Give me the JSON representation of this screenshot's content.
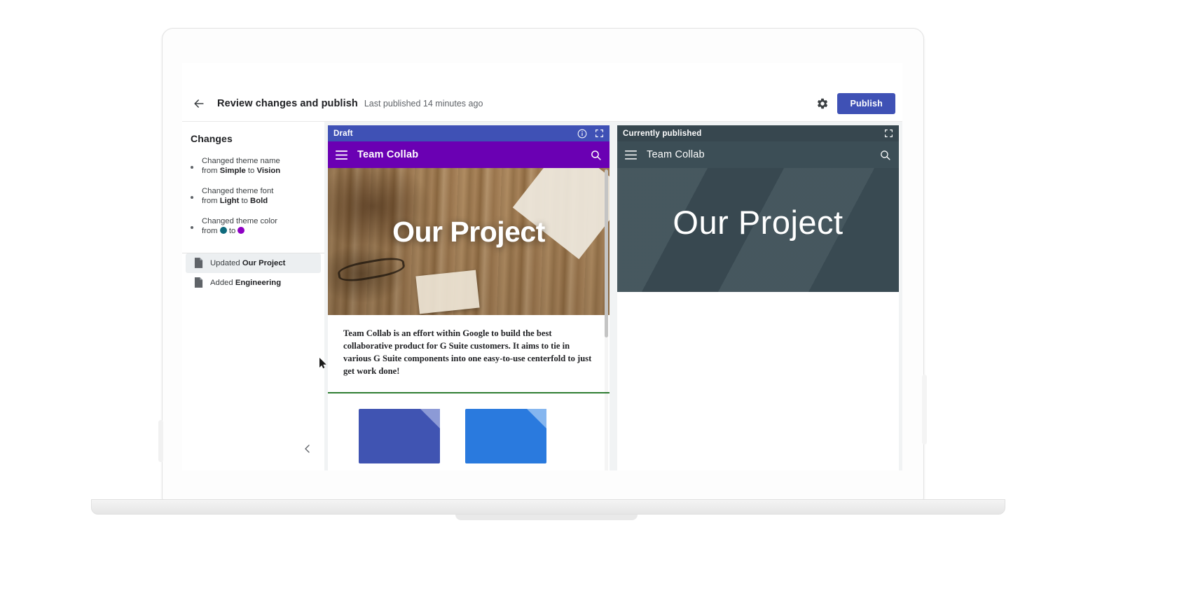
{
  "toolbar": {
    "back_icon": "arrow-left-icon",
    "title": "Review changes and publish",
    "subtitle": "Last published 14 minutes ago",
    "gear_icon": "gear-icon",
    "publish_label": "Publish",
    "publish_color": "#3f51b5"
  },
  "changes": {
    "heading": "Changes",
    "items": [
      {
        "prefix": "Changed theme name",
        "line2_pre": "from ",
        "from": "Simple",
        "mid": " to ",
        "to": "Vision",
        "type": "text"
      },
      {
        "prefix": "Changed theme font",
        "line2_pre": "from ",
        "from": "Light",
        "mid": " to ",
        "to": "Bold",
        "type": "text"
      },
      {
        "prefix": "Changed theme color",
        "line2_pre": "from ",
        "from_color": "#0f6b7d",
        "mid": " to ",
        "to_color": "#8e00c4",
        "type": "color"
      }
    ],
    "pages": [
      {
        "icon": "page-icon",
        "action": "Updated ",
        "name": "Our Project",
        "selected": true
      },
      {
        "icon": "page-icon",
        "action": "Added ",
        "name": "Engineering",
        "selected": false
      }
    ],
    "collapse_icon": "chevron-left-icon"
  },
  "draft_panel": {
    "header_label": "Draft",
    "header_color": "#3f51b5",
    "info_icon": "info-icon",
    "fullscreen_icon": "fullscreen-icon",
    "site": {
      "menu_icon": "hamburger-icon",
      "name": "Team Collab",
      "search_icon": "search-icon",
      "bar_color": "#6a00b3",
      "hero_title": "Our Project",
      "body_text": "Team Collab is an effort within Google to build the best collaborative product for G Suite customers. It aims to tie in various G Suite components into one easy-to-use centerfold to just get work done!",
      "accent_rule_color": "#2e7d32"
    }
  },
  "published_panel": {
    "header_label": "Currently published",
    "header_color": "#37474f",
    "fullscreen_icon": "fullscreen-icon",
    "site": {
      "menu_icon": "hamburger-icon",
      "name": "Team Collab",
      "search_icon": "search-icon",
      "bar_color": "#3c4e56",
      "hero_title": "Our Project"
    }
  }
}
